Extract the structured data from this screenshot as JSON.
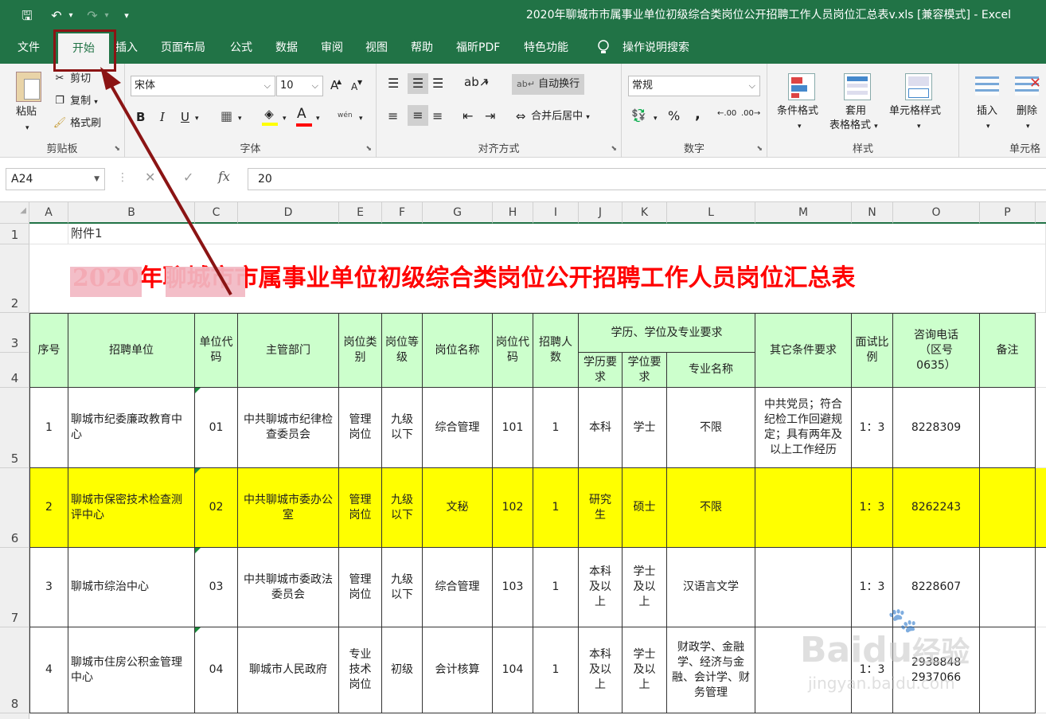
{
  "window": {
    "title": "2020年聊城市市属事业单位初级综合类岗位公开招聘工作人员岗位汇总表v.xls  [兼容模式]  -  Excel"
  },
  "quick_access": {
    "save": "🖫",
    "undo": "↶",
    "redo": "↷",
    "more": "▾"
  },
  "menu": [
    "文件",
    "开始",
    "插入",
    "页面布局",
    "公式",
    "数据",
    "审阅",
    "视图",
    "帮助",
    "福昕PDF",
    "特色功能",
    "操作说明搜索"
  ],
  "ribbon": {
    "clipboard": {
      "paste": "粘贴",
      "cut": "剪切",
      "copy": "复制",
      "format_painter": "格式刷",
      "label": "剪贴板"
    },
    "font": {
      "name": "宋体",
      "size": "10",
      "bold": "B",
      "italic": "I",
      "underline": "U",
      "grow": "A",
      "shrink": "A",
      "font_color_letter": "A",
      "phonetic": "wén",
      "label": "字体"
    },
    "alignment": {
      "wrap": "自动换行",
      "merge": "合并后居中",
      "label": "对齐方式"
    },
    "number": {
      "format": "常规",
      "percent": "%",
      "comma": ",",
      "inc": ".00",
      "dec": ".00",
      "label": "数字"
    },
    "styles": {
      "conditional": "条件格式",
      "table_line1": "套用",
      "table_line2": "表格格式",
      "cell_styles": "单元格样式",
      "label": "样式"
    },
    "cells": {
      "insert": "插入",
      "delete": "删除",
      "label": "单元格"
    }
  },
  "formula_bar": {
    "name_box": "A24",
    "fx": "fx",
    "value": "20"
  },
  "columns": [
    "A",
    "B",
    "C",
    "D",
    "E",
    "F",
    "G",
    "H",
    "I",
    "J",
    "K",
    "L",
    "M",
    "N",
    "O",
    "P"
  ],
  "rows": [
    "1",
    "2",
    "3",
    "4",
    "5",
    "6",
    "7",
    "8"
  ],
  "sheet": {
    "attachment": "附件1",
    "title": "2020年聊城市市属事业单位初级综合类岗位公开招聘工作人员岗位汇总表",
    "headers": {
      "seq": "序号",
      "unit": "招聘单位",
      "unit_code": "单位代码",
      "dept": "主管部门",
      "post_type": "岗位类别",
      "post_level": "岗位等级",
      "post_name": "岗位名称",
      "post_code": "岗位代码",
      "count": "招聘人数",
      "edu_group": "学历、学位及专业要求",
      "edu": "学历要求",
      "degree": "学位要求",
      "major": "专业名称",
      "other": "其它条件要求",
      "ratio": "面试比例",
      "phone": "咨询电话（区号0635）",
      "note": "备注"
    },
    "data": [
      {
        "seq": "1",
        "unit": "聊城市纪委廉政教育中心",
        "unit_code": "01",
        "dept": "中共聊城市纪律检查委员会",
        "post_type": "管理岗位",
        "post_level": "九级以下",
        "post_name": "综合管理",
        "post_code": "101",
        "count": "1",
        "edu": "本科",
        "degree": "学士",
        "major": "不限",
        "other": "中共党员；符合纪检工作回避规定；具有两年及以上工作经历",
        "ratio": "1：3",
        "phone": "8228309",
        "note": ""
      },
      {
        "seq": "2",
        "unit": "聊城市保密技术检查测评中心",
        "unit_code": "02",
        "dept": "中共聊城市委办公室",
        "post_type": "管理岗位",
        "post_level": "九级以下",
        "post_name": "文秘",
        "post_code": "102",
        "count": "1",
        "edu": "研究生",
        "degree": "硕士",
        "major": "不限",
        "other": "",
        "ratio": "1：3",
        "phone": "8262243",
        "note": ""
      },
      {
        "seq": "3",
        "unit": "聊城市综治中心",
        "unit_code": "03",
        "dept": "中共聊城市委政法委员会",
        "post_type": "管理岗位",
        "post_level": "九级以下",
        "post_name": "综合管理",
        "post_code": "103",
        "count": "1",
        "edu": "本科及以上",
        "degree": "学士及以上",
        "major": "汉语言文学",
        "other": "",
        "ratio": "1：3",
        "phone": "8228607",
        "note": ""
      },
      {
        "seq": "4",
        "unit": "聊城市住房公积金管理中心",
        "unit_code": "04",
        "dept": "聊城市人民政府",
        "post_type": "专业技术岗位",
        "post_level": "初级",
        "post_name": "会计核算",
        "post_code": "104",
        "count": "1",
        "edu": "本科及以上",
        "degree": "学士及以上",
        "major": "财政学、金融学、经济与金融、会计学、财务管理",
        "other": "",
        "ratio": "1：3",
        "phone": "2938848 2937066",
        "note": ""
      }
    ]
  },
  "watermark": {
    "brand": "Baidu",
    "brand_cn": "经验",
    "url": "jingyan.baidu.com"
  },
  "colors": {
    "excel_green": "#217346",
    "header_green": "#ccffcc",
    "highlight_yellow": "#ffff00",
    "title_red": "#ff0000",
    "annotation": "#8b1414"
  }
}
